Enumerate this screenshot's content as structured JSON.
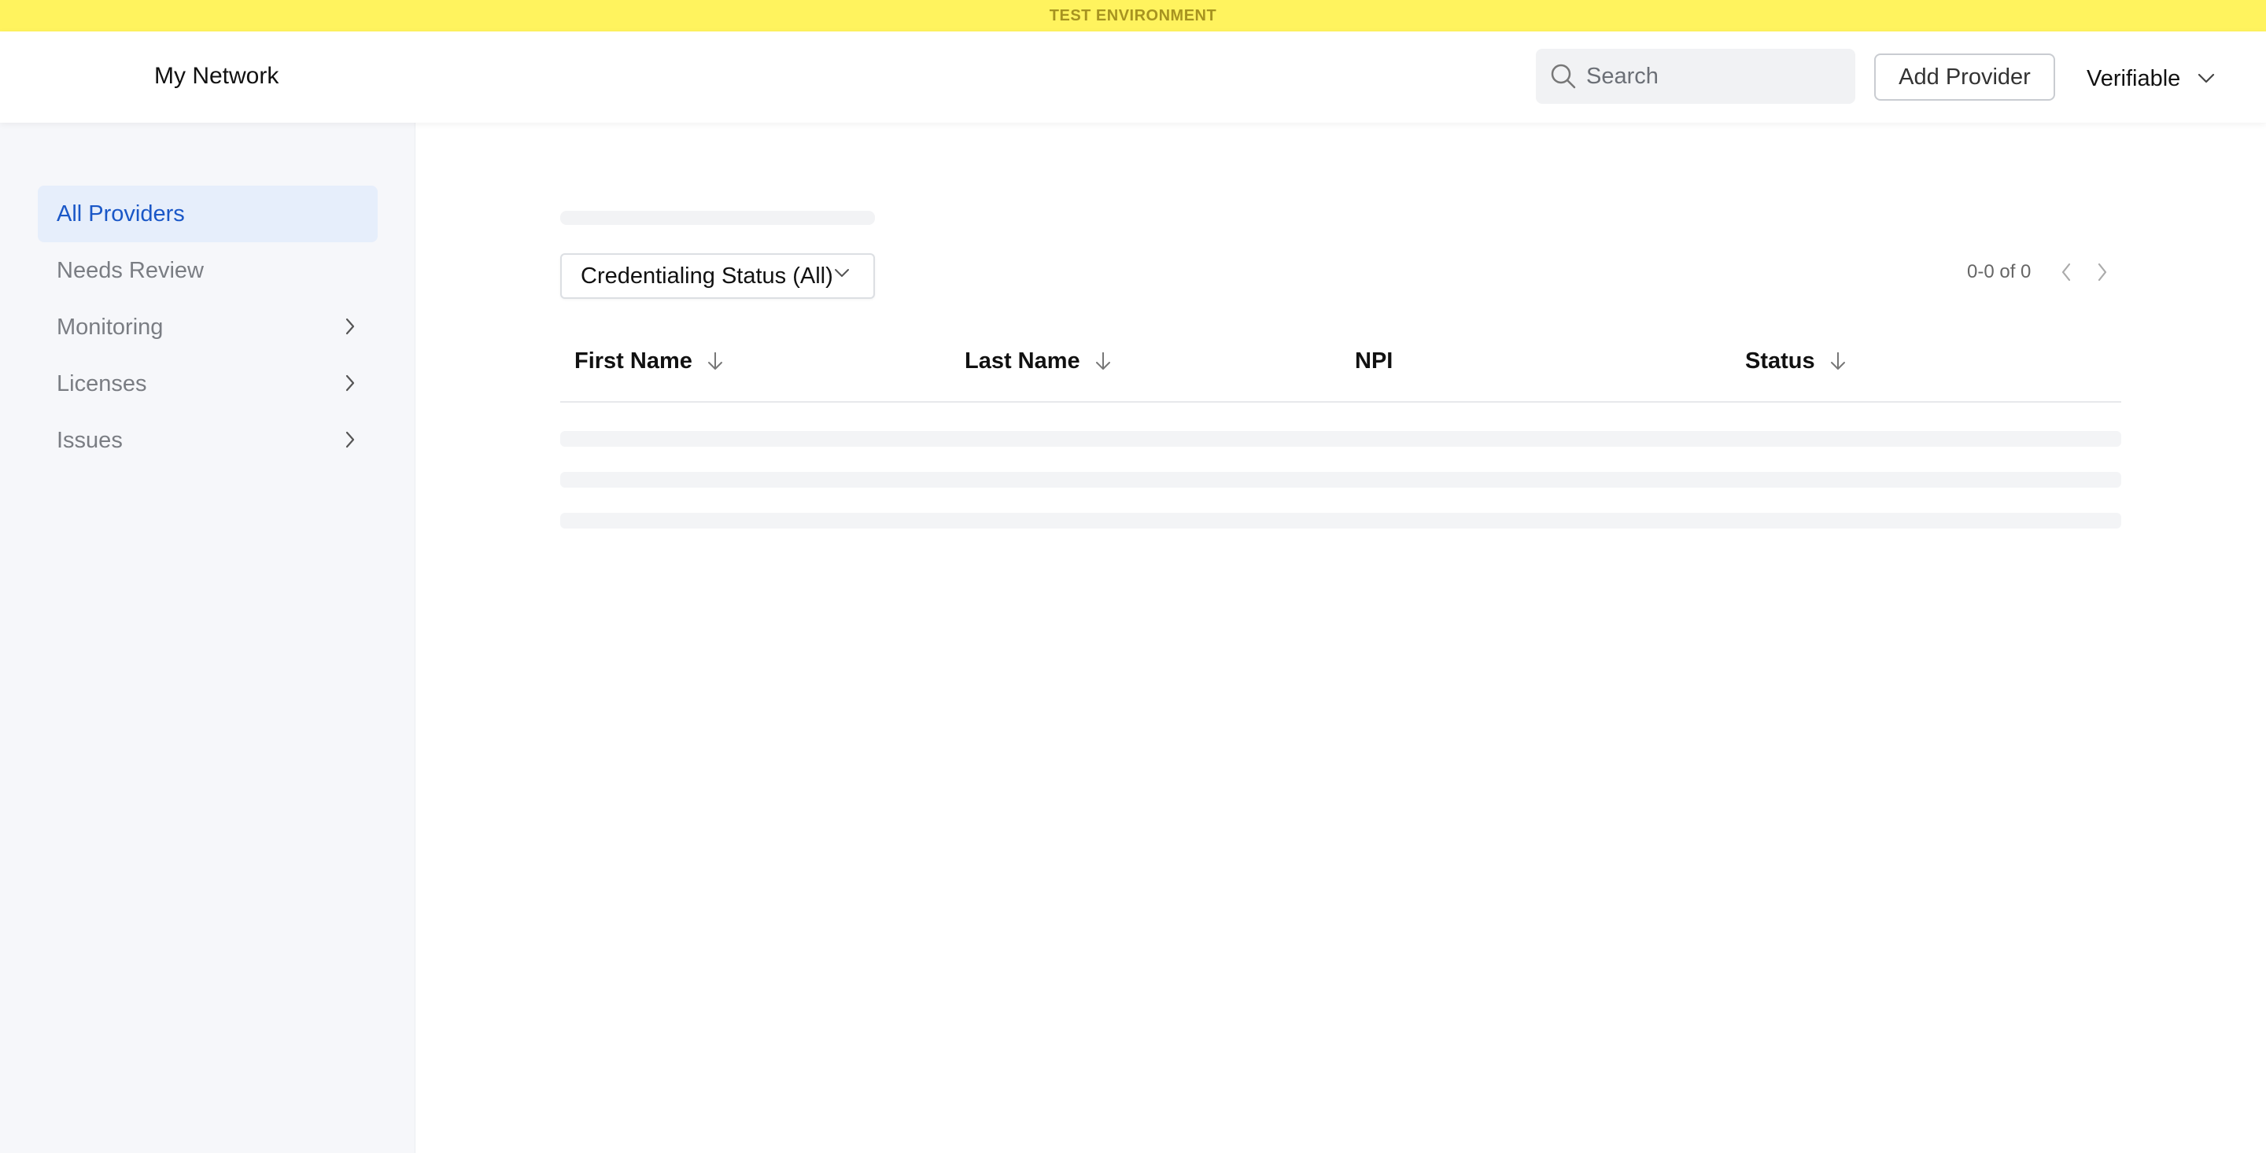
{
  "env_banner": "TEST ENVIRONMENT",
  "header": {
    "title": "My Network",
    "search_placeholder": "Search",
    "add_provider_label": "Add Provider",
    "org_name": "Verifiable"
  },
  "sidebar": {
    "items": [
      {
        "label": "All Providers",
        "active": true,
        "has_submenu": false
      },
      {
        "label": "Needs Review",
        "active": false,
        "has_submenu": false
      },
      {
        "label": "Monitoring",
        "active": false,
        "has_submenu": true
      },
      {
        "label": "Licenses",
        "active": false,
        "has_submenu": true
      },
      {
        "label": "Issues",
        "active": false,
        "has_submenu": true
      }
    ]
  },
  "filters": {
    "credentialing_status_label": "Credentialing Status (All)"
  },
  "pagination": {
    "range_text": "0-0 of 0"
  },
  "table": {
    "columns": [
      {
        "label": "First Name",
        "sortable": true
      },
      {
        "label": "Last Name",
        "sortable": true
      },
      {
        "label": "NPI",
        "sortable": false
      },
      {
        "label": "Status",
        "sortable": true
      }
    ],
    "rows": []
  },
  "colors": {
    "banner_bg": "#fff35e",
    "banner_text": "#a79320",
    "active_nav_bg": "#e6eefb",
    "active_nav_text": "#1a57c7",
    "sidebar_bg": "#f6f7fa"
  }
}
